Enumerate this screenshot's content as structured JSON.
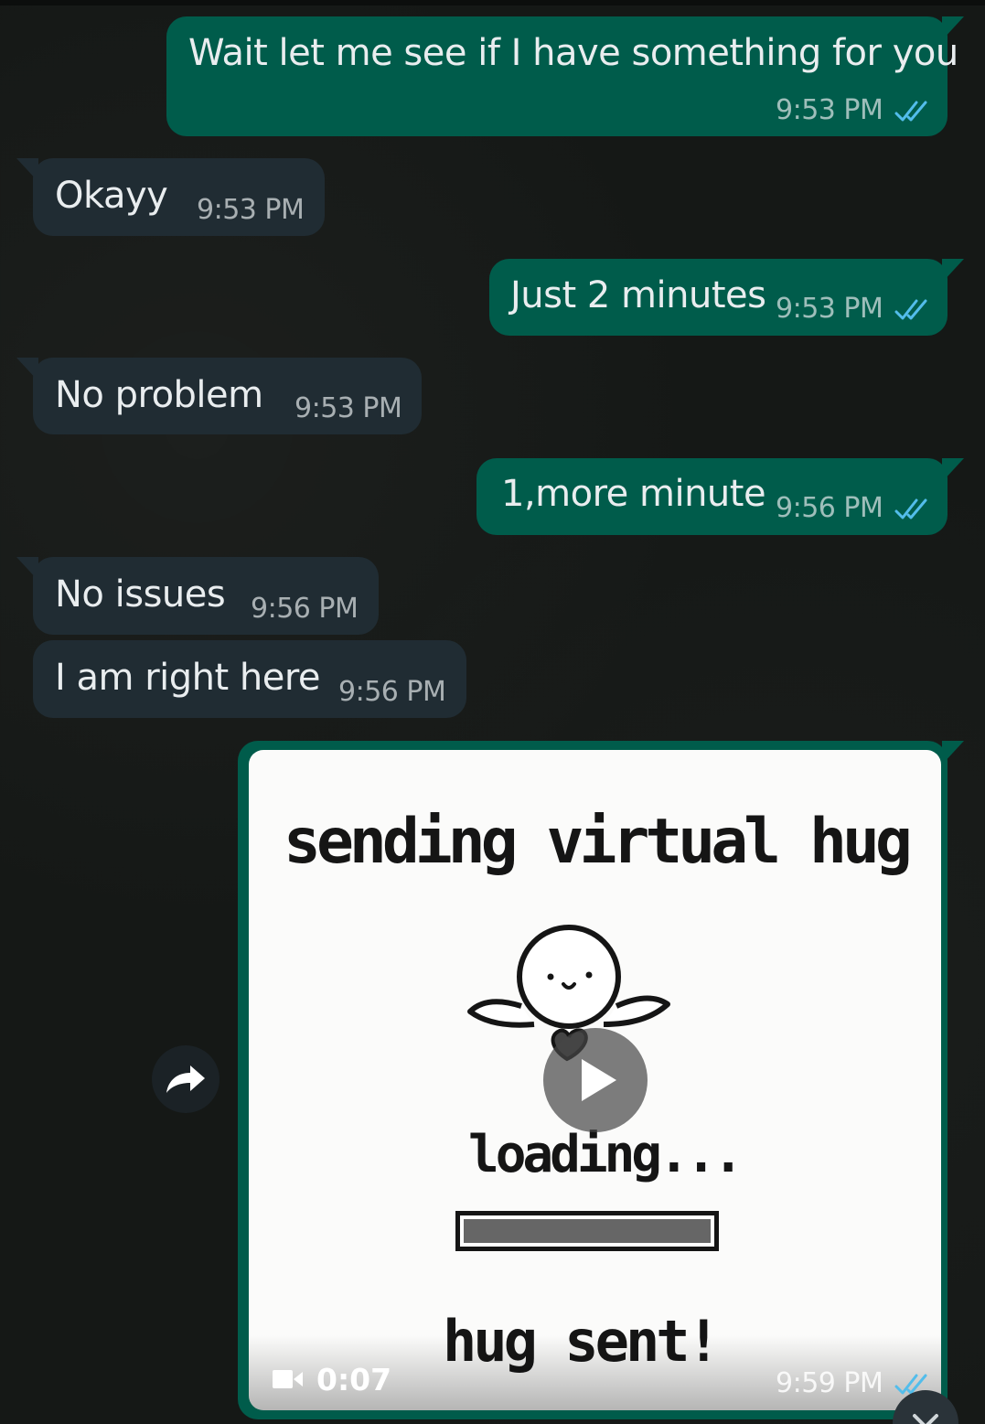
{
  "messages": [
    {
      "text": "Wait let me see if I have something for you",
      "time": "9:53 PM",
      "direction": "outgoing",
      "status": "read"
    },
    {
      "text": "Okayy",
      "time": "9:53 PM",
      "direction": "incoming"
    },
    {
      "text": "Just 2 minutes",
      "time": "9:53 PM",
      "direction": "outgoing",
      "status": "read"
    },
    {
      "text": "No problem",
      "time": "9:53 PM",
      "direction": "incoming"
    },
    {
      "text": "1,more minute",
      "time": "9:56 PM",
      "direction": "outgoing",
      "status": "read"
    },
    {
      "text": "No issues",
      "time": "9:56 PM",
      "direction": "incoming"
    },
    {
      "text": "I am right here",
      "time": "9:56 PM",
      "direction": "incoming"
    }
  ],
  "video_message": {
    "caption_lines": [
      "sending virtual hug",
      "loading...",
      "hug sent!"
    ],
    "duration": "0:07",
    "time": "9:59 PM",
    "status": "read",
    "loading_progress": 1.0
  },
  "icons": {
    "read_ticks": "double-check-icon",
    "play": "play-icon",
    "video": "video-camera-icon",
    "forward": "forward-icon",
    "scroll_down": "chevron-down-icon"
  },
  "colors": {
    "background": "#151816",
    "outgoing_bubble": "#005c4b",
    "incoming_bubble": "#202c33",
    "read_tick": "#53bdeb"
  }
}
